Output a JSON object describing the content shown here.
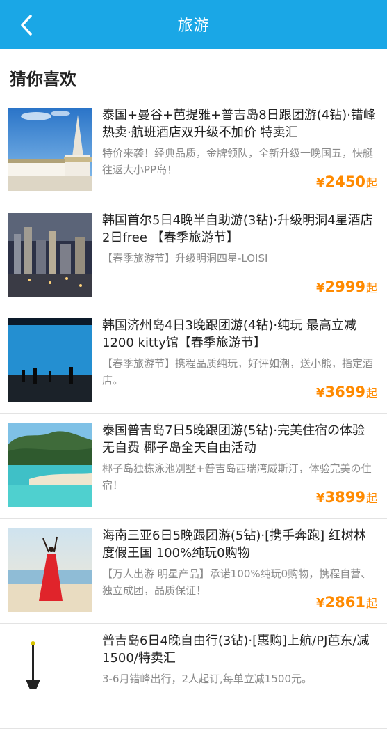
{
  "header": {
    "title": "旅游",
    "back_icon": "chevron-left-icon"
  },
  "section_title": "猜你喜欢",
  "colors": {
    "header_bg": "#1aa7e6",
    "price": "#ff8a00"
  },
  "products": [
    {
      "name": "泰国+曼谷+芭提雅+普吉岛8日跟团游(4钻)·错峰热卖·航班酒店双升级不加价 特卖汇",
      "desc": "特价来袭！经典品质，金牌领队，全新升级一晚国五，快艇往返大小PP岛！",
      "currency": "¥",
      "price": "2450",
      "unit": "起"
    },
    {
      "name": "韩国首尔5日4晚半自助游(3钻)·升级明洞4星酒店 2日free 【春季旅游节】",
      "desc": "【春季旅游节】升级明洞四星-LOISI",
      "currency": "¥",
      "price": "2999",
      "unit": "起"
    },
    {
      "name": "韩国济州岛4日3晚跟团游(4钻)·纯玩 最高立减1200 kitty馆【春季旅游节】",
      "desc": "【春季旅游节】携程品质纯玩，好评如潮，送小熊，指定酒店。",
      "currency": "¥",
      "price": "3699",
      "unit": "起"
    },
    {
      "name": "泰国普吉岛7日5晚跟团游(5钻)·完美住宿の体验 无自费 椰子岛全天自由活动",
      "desc": "椰子岛独栋泳池别墅+普吉岛西瑞湾威斯汀，体验完美の住宿！",
      "currency": "¥",
      "price": "3899",
      "unit": "起"
    },
    {
      "name": "海南三亚6日5晚跟团游(5钻)·[携手奔跑] 红树林度假王国 100%纯玩0购物",
      "desc": "【万人出游 明星产品】承诺100%纯玩0购物，携程自营、独立成团，品质保证！",
      "currency": "¥",
      "price": "2861",
      "unit": "起"
    },
    {
      "name": "普吉岛6日4晚自由行(3钻)·[惠购]上航/PJ芭东/减1500/特卖汇",
      "desc": "3-6月错峰出行，2人起订,每单立减1500元。",
      "currency": "¥",
      "price": "",
      "unit": ""
    }
  ]
}
